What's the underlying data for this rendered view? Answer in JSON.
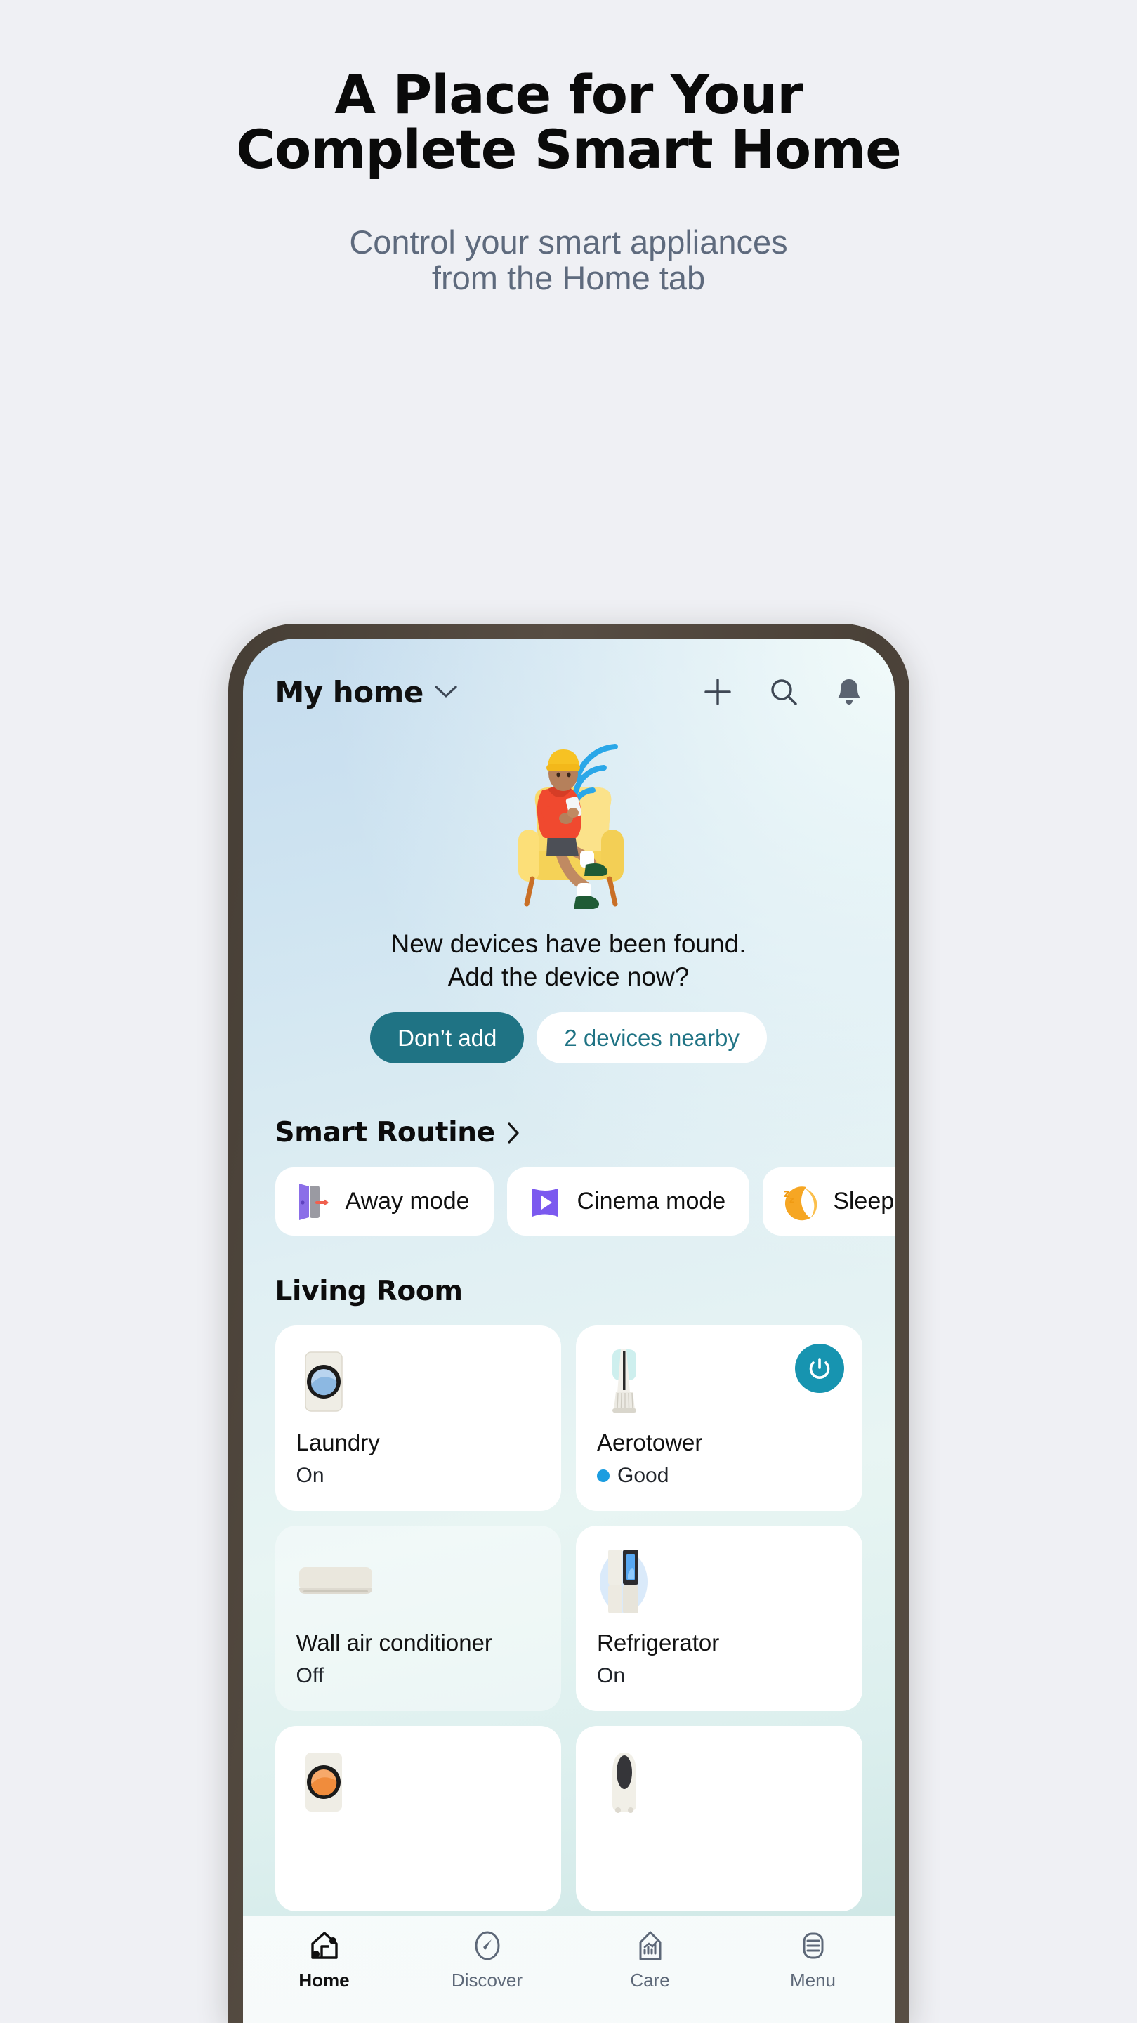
{
  "promo": {
    "title_line1": "A Place for Your",
    "title_line2": "Complete Smart Home",
    "subtitle_line1": "Control your smart appliances",
    "subtitle_line2": "from the Home tab"
  },
  "colors": {
    "page_bg": "#eff0f4",
    "title": "#0a0a0a",
    "subtitle": "#5e6a7d",
    "phone_bezel": "#4e453b",
    "accent_teal": "#1f7384",
    "power_teal": "#1794b0",
    "status_dot_blue": "#1b9de0"
  },
  "appbar": {
    "home_label": "My home",
    "dropdown_icon": "chevron-down-icon",
    "icons": [
      "plus-icon",
      "search-icon",
      "bell-icon"
    ]
  },
  "hero": {
    "illustration": "person-in-armchair-with-phone-wifi-illustration",
    "message_line1": "New devices have been found.",
    "message_line2": "Add the device now?",
    "primary_button": "Don’t add",
    "secondary_button": "2 devices nearby"
  },
  "smart_routine": {
    "title": "Smart Routine",
    "chevron_icon": "chevron-right-icon",
    "chips": [
      {
        "label": "Away mode",
        "icon": "open-door-icon"
      },
      {
        "label": "Cinema mode",
        "icon": "play-screen-icon"
      },
      {
        "label": "Sleep",
        "icon": "crescent-moon-zzz-icon"
      }
    ]
  },
  "rooms": [
    {
      "name": "Living Room",
      "devices": [
        {
          "name": "Laundry",
          "state": "On",
          "icon": "washing-machine-icon",
          "off": false,
          "power_button": false,
          "status_dot": false
        },
        {
          "name": "Aerotower",
          "state": "Good",
          "icon": "air-purifier-tower-icon",
          "off": false,
          "power_button": true,
          "status_dot": true
        },
        {
          "name": "Wall air conditioner",
          "state": "Off",
          "icon": "wall-air-conditioner-icon",
          "off": true,
          "power_button": false,
          "status_dot": false
        },
        {
          "name": "Refrigerator",
          "state": "On",
          "icon": "refrigerator-icon",
          "off": false,
          "power_button": false,
          "status_dot": false
        },
        {
          "name": "",
          "state": "",
          "icon": "dryer-icon",
          "off": false,
          "power_button": false,
          "status_dot": false
        },
        {
          "name": "",
          "state": "",
          "icon": "air-purifier-icon",
          "off": false,
          "power_button": false,
          "status_dot": false
        }
      ]
    }
  ],
  "bottom_nav": [
    {
      "label": "Home",
      "icon": "home-icon",
      "active": true
    },
    {
      "label": "Discover",
      "icon": "compass-icon",
      "active": false
    },
    {
      "label": "Care",
      "icon": "house-chart-icon",
      "active": false
    },
    {
      "label": "Menu",
      "icon": "hamburger-menu-icon",
      "active": false
    }
  ]
}
